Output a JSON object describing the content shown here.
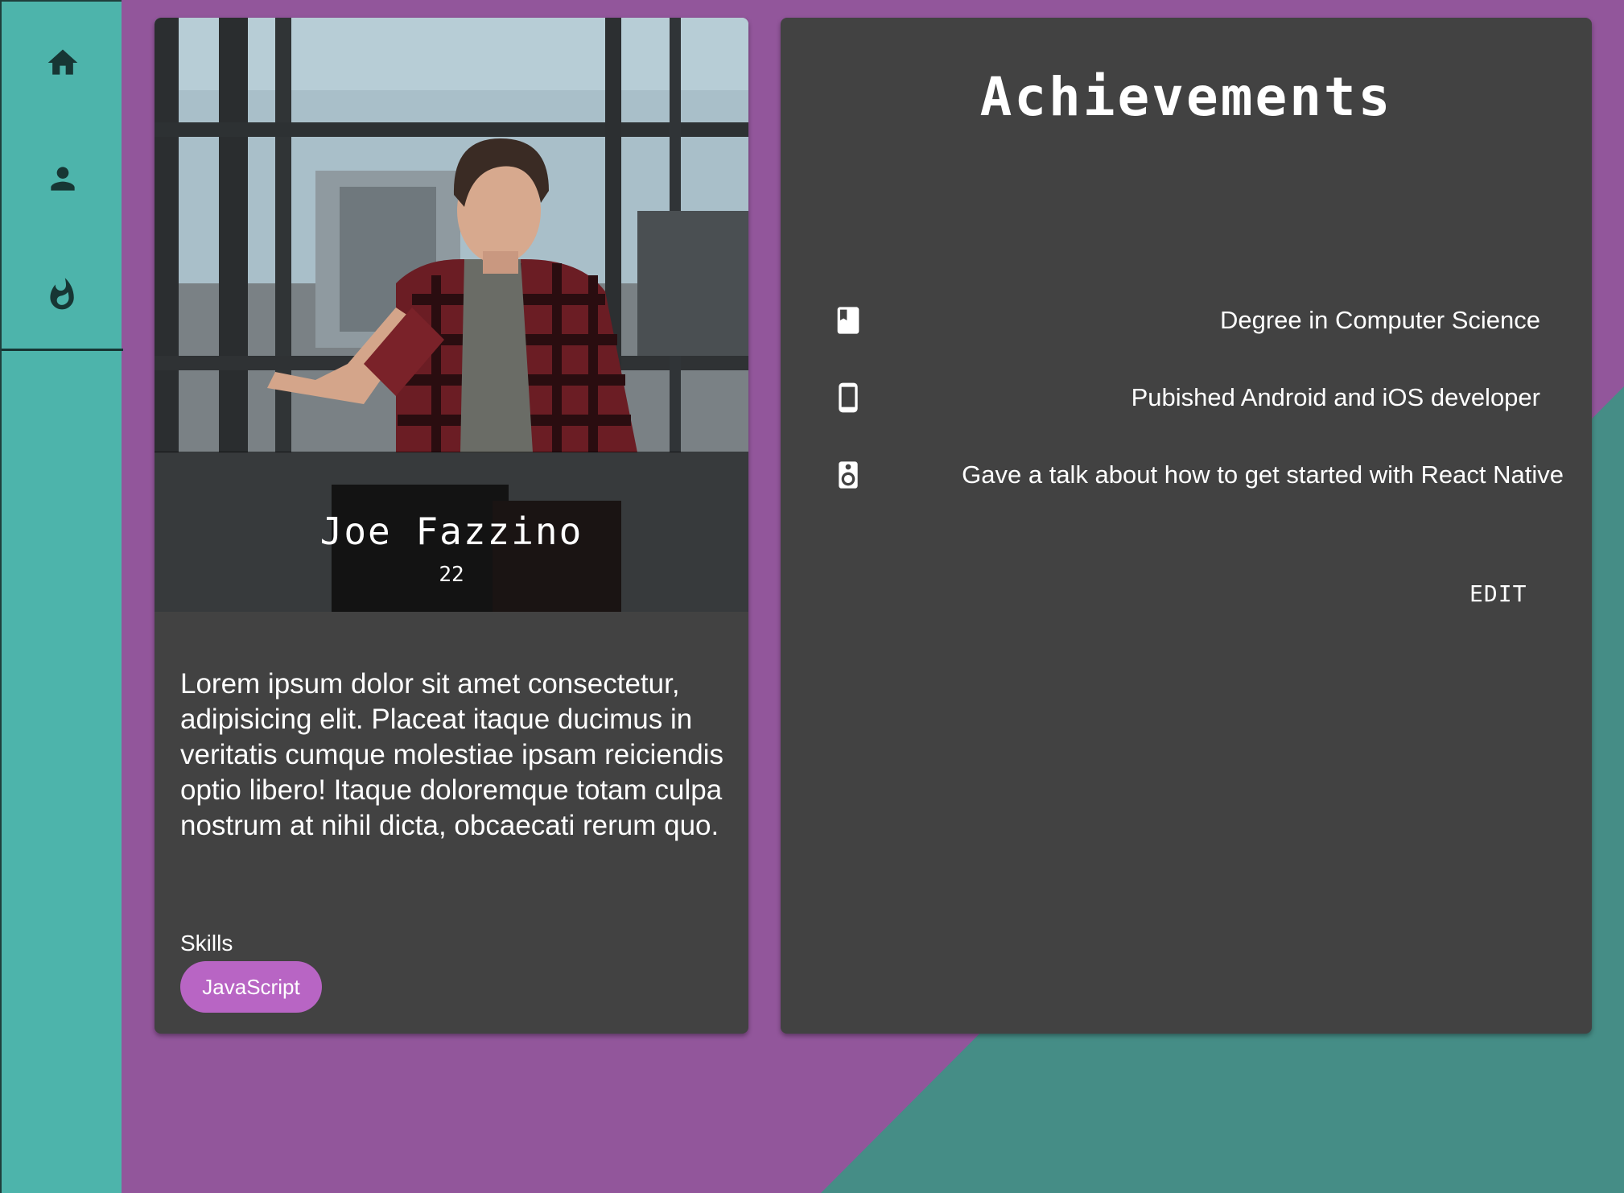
{
  "colors": {
    "background_purple": "#92569b",
    "background_teal": "#458d86",
    "rail": "#4db4ab",
    "card": "#424242",
    "chip": "#b865c4",
    "icon_dark": "#173634"
  },
  "nav": {
    "items": [
      {
        "icon": "home-icon"
      },
      {
        "icon": "person-icon"
      },
      {
        "icon": "fire-icon"
      }
    ]
  },
  "profile": {
    "name": "Joe Fazzino",
    "age": "22",
    "bio": "Lorem ipsum dolor sit amet consectetur, adipisicing elit. Placeat itaque ducimus in veritatis cumque molestiae ipsam reiciendis optio libero! Itaque doloremque totam culpa nostrum at nihil dicta, obcaecati rerum quo.",
    "skills_label": "Skills",
    "skills": [
      "JavaScript"
    ]
  },
  "achievements": {
    "title": "Achievements",
    "items": [
      {
        "icon": "book-icon",
        "text": "Degree in Computer Science"
      },
      {
        "icon": "phone-icon",
        "text": "Pubished Android and iOS developer"
      },
      {
        "icon": "speaker-icon",
        "text": "Gave a talk about how to get started with React Native"
      }
    ],
    "edit_label": "EDIT"
  }
}
